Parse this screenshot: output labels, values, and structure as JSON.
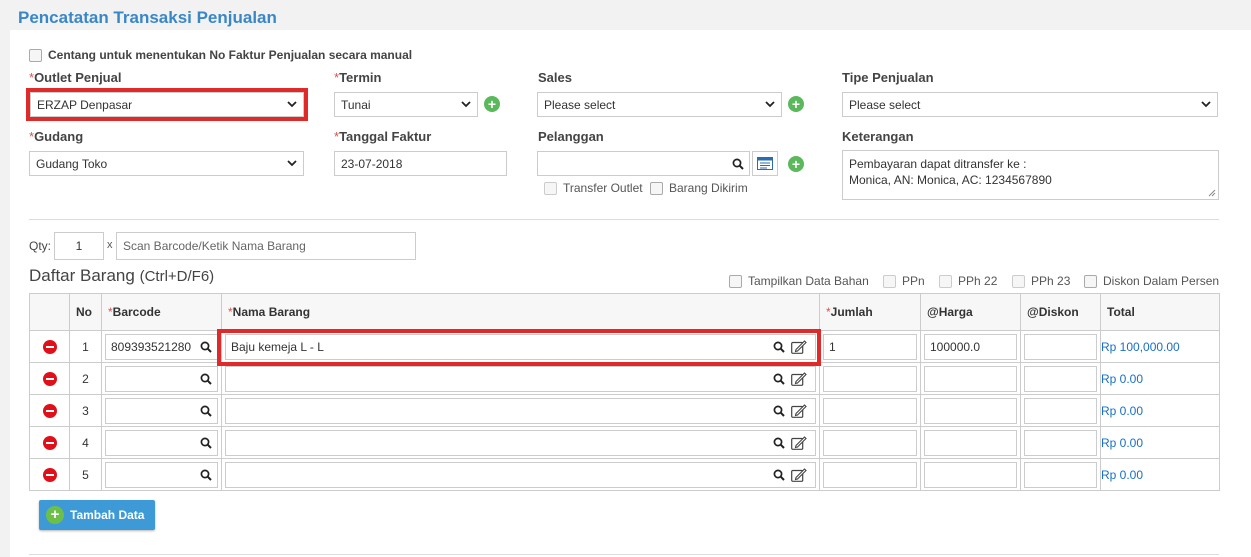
{
  "page_title": "Pencatatan Transaksi Penjualan",
  "manual_invoice_label": "Centang untuk menentukan No Faktur Penjualan secara manual",
  "form": {
    "outlet_label": "Outlet Penjual",
    "outlet_value": "ERZAP Denpasar",
    "termin_label": "Termin",
    "termin_value": "Tunai",
    "sales_label": "Sales",
    "sales_value": "Please select",
    "tipe_label": "Tipe Penjualan",
    "tipe_value": "Please select",
    "gudang_label": "Gudang",
    "gudang_value": "Gudang Toko",
    "tanggal_label": "Tanggal Faktur",
    "tanggal_value": "23-07-2018",
    "pelanggan_label": "Pelanggan",
    "pelanggan_value": "",
    "transfer_outlet_label": "Transfer Outlet",
    "barang_dikirim_label": "Barang Dikirim",
    "keterangan_label": "Keterangan",
    "keterangan_line1": "Pembayaran dapat ditransfer ke :",
    "keterangan_line2": "Monica, AN: Monica, AC: 1234567890",
    "required_mark": "*"
  },
  "scan": {
    "qty_label": "Qty:",
    "qty_value": "1",
    "x_label": "x",
    "placeholder": "Scan Barcode/Ketik Nama Barang"
  },
  "list": {
    "title": "Daftar Barang",
    "shortcut": "(Ctrl+D/F6)",
    "opt_bahan": "Tampilkan Data Bahan",
    "opt_ppn": "PPn",
    "opt_pph22": "PPh 22",
    "opt_pph23": "PPh 23",
    "opt_diskon": "Diskon Dalam Persen"
  },
  "table": {
    "headers": {
      "no": "No",
      "barcode": "Barcode",
      "nama": "Nama Barang",
      "jumlah": "Jumlah",
      "harga": "@Harga",
      "diskon": "@Diskon",
      "total": "Total"
    },
    "rows": [
      {
        "no": "1",
        "barcode": "809393521280",
        "nama": "Baju kemeja L - L",
        "jumlah": "1",
        "harga": "100000.0",
        "diskon": "",
        "total": "Rp 100,000.00"
      },
      {
        "no": "2",
        "barcode": "",
        "nama": "",
        "jumlah": "",
        "harga": "",
        "diskon": "",
        "total": "Rp 0.00"
      },
      {
        "no": "3",
        "barcode": "",
        "nama": "",
        "jumlah": "",
        "harga": "",
        "diskon": "",
        "total": "Rp 0.00"
      },
      {
        "no": "4",
        "barcode": "",
        "nama": "",
        "jumlah": "",
        "harga": "",
        "diskon": "",
        "total": "Rp 0.00"
      },
      {
        "no": "5",
        "barcode": "",
        "nama": "",
        "jumlah": "",
        "harga": "",
        "diskon": "",
        "total": "Rp 0.00"
      }
    ]
  },
  "add_button_label": "Tambah Data",
  "colors": {
    "title": "#3a87c8",
    "highlight": "#e02a2a",
    "add_icon": "#5cb85c",
    "delete_icon": "#e0101a",
    "total_text": "#1a6fc4"
  }
}
